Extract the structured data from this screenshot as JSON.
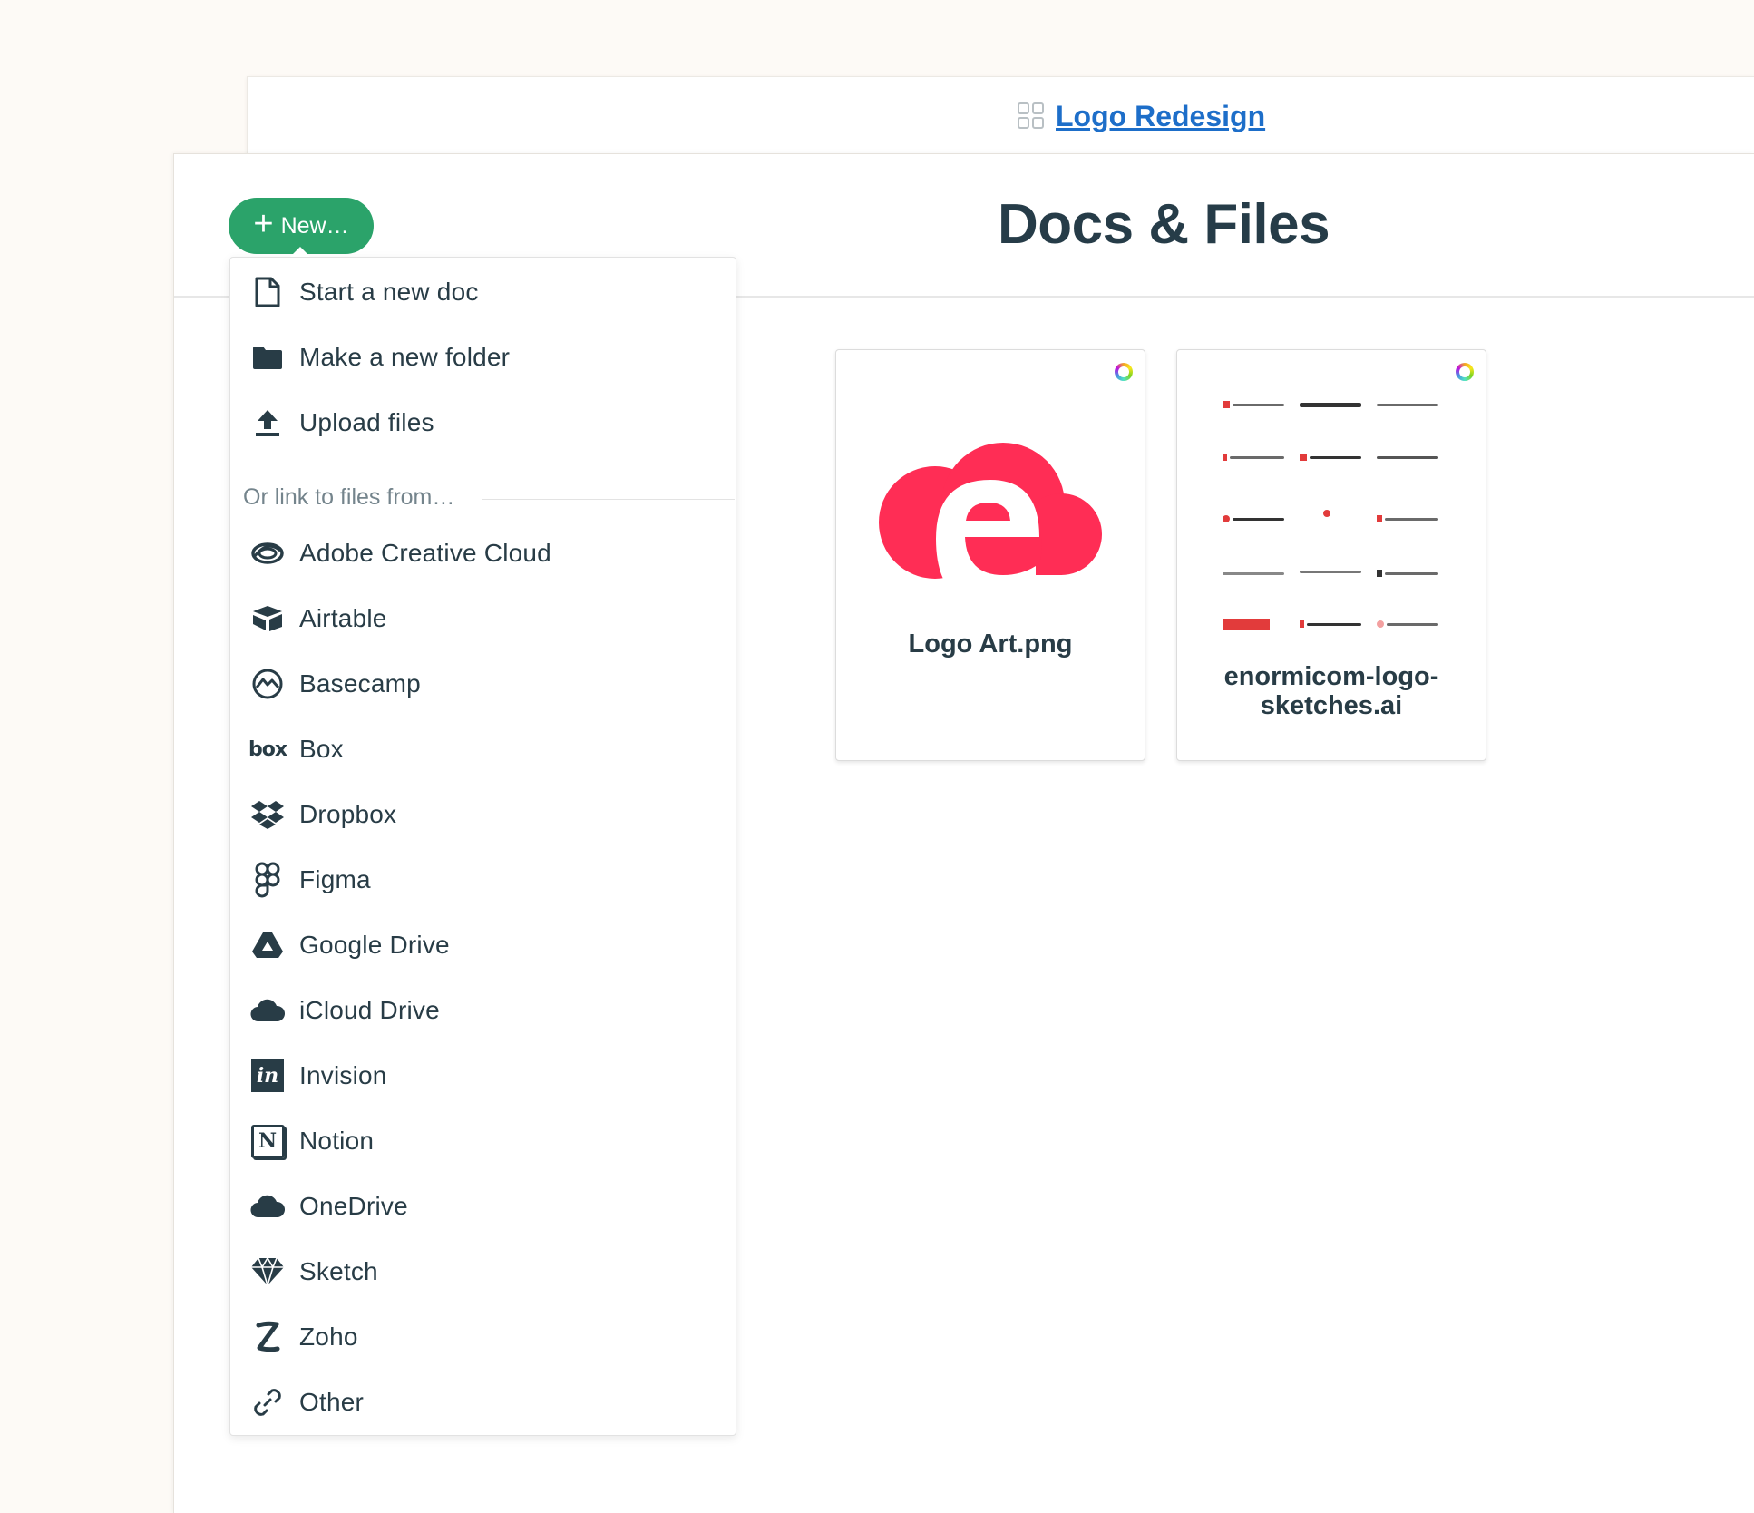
{
  "header": {
    "breadcrumb_icon": "grid-icon",
    "project_link": "Logo Redesign"
  },
  "page": {
    "title": "Docs & Files"
  },
  "new_button": {
    "label": "New…",
    "icon": "plus-icon",
    "color": "#2ba36a"
  },
  "menu": {
    "create_items": [
      {
        "label": "Start a new doc",
        "icon": "document-icon"
      },
      {
        "label": "Make a new folder",
        "icon": "folder-icon"
      },
      {
        "label": "Upload files",
        "icon": "upload-icon"
      }
    ],
    "link_heading": "Or link to files from…",
    "link_items": [
      {
        "label": "Adobe Creative Cloud",
        "icon": "adobe-creative-cloud-icon"
      },
      {
        "label": "Airtable",
        "icon": "airtable-icon"
      },
      {
        "label": "Basecamp",
        "icon": "basecamp-icon"
      },
      {
        "label": "Box",
        "icon": "box-icon"
      },
      {
        "label": "Dropbox",
        "icon": "dropbox-icon"
      },
      {
        "label": "Figma",
        "icon": "figma-icon"
      },
      {
        "label": "Google Drive",
        "icon": "google-drive-icon"
      },
      {
        "label": "iCloud Drive",
        "icon": "icloud-icon"
      },
      {
        "label": "Invision",
        "icon": "invision-icon"
      },
      {
        "label": "Notion",
        "icon": "notion-icon"
      },
      {
        "label": "OneDrive",
        "icon": "onedrive-icon"
      },
      {
        "label": "Sketch",
        "icon": "sketch-icon"
      },
      {
        "label": "Zoho",
        "icon": "zoho-icon"
      },
      {
        "label": "Other",
        "icon": "link-icon"
      }
    ]
  },
  "files": [
    {
      "name": "Logo Art.png",
      "thumbnail": "logo-art-thumbnail",
      "accent": "#ff2d55"
    },
    {
      "name": "enormicom-logo-sketches.ai",
      "thumbnail": "logo-sketches-thumbnail"
    }
  ]
}
